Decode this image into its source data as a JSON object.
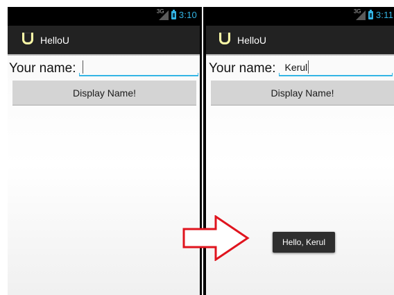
{
  "colors": {
    "accent": "#33b5e5",
    "action_bar": "#222222",
    "status_bar": "#000000",
    "button": "#d4d4d4",
    "toast": "#2e2e2e",
    "arrow": "#e0141e",
    "app_icon": "#fcfaa6"
  },
  "screens": [
    {
      "status": {
        "network": "3G",
        "time": "3:10",
        "icons": [
          "signal-icon",
          "battery-icon"
        ]
      },
      "app": {
        "title": "HelloU",
        "icon": "app-u-icon"
      },
      "form": {
        "label": "Your name:",
        "input_value": "",
        "button_label": "Display Name!"
      }
    },
    {
      "status": {
        "network": "3G",
        "time": "3:11",
        "icons": [
          "signal-icon",
          "battery-icon"
        ]
      },
      "app": {
        "title": "HelloU",
        "icon": "app-u-icon"
      },
      "form": {
        "label": "Your name:",
        "input_value": "Kerul",
        "button_label": "Display Name!"
      },
      "toast": "Hello, Kerul"
    }
  ],
  "transition": {
    "icon": "right-arrow-icon"
  }
}
